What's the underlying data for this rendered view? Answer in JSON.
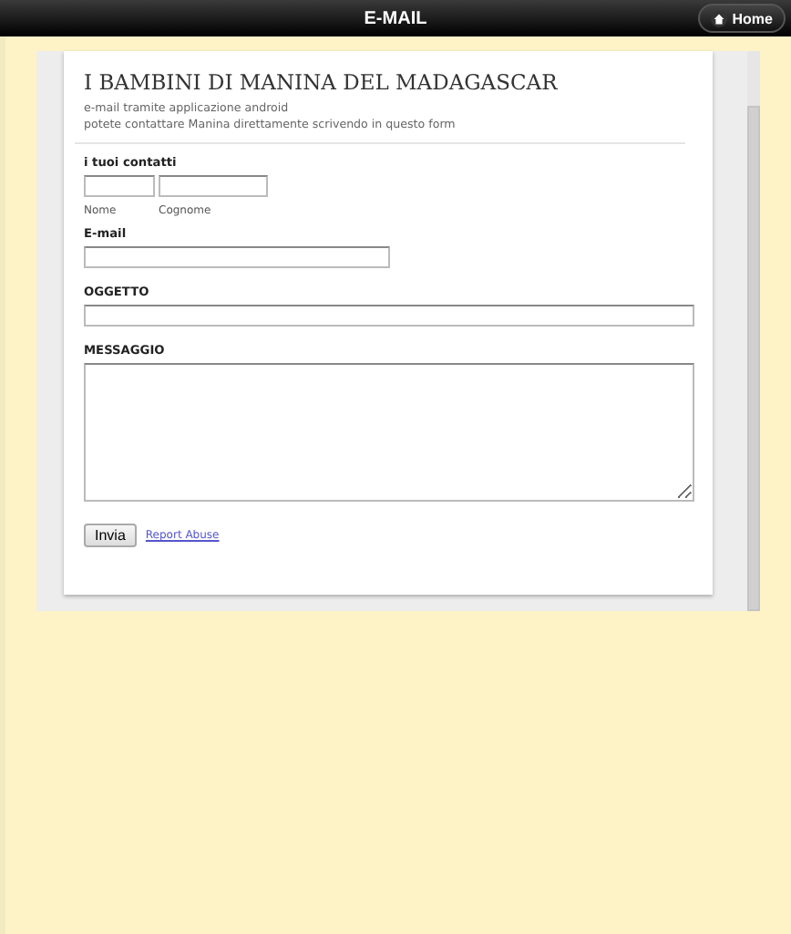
{
  "header": {
    "title": "E-MAIL",
    "home_button": "Home"
  },
  "form": {
    "title": "I BAMBINI DI MANINA DEL MADAGASCAR",
    "description": [
      "e-mail tramite applicazione android",
      "potete contattare Manina direttamente scrivendo in questo form"
    ],
    "contacts_label": "i tuoi contatti",
    "first_name_caption": "Nome",
    "last_name_caption": "Cognome",
    "email_label": "E-mail",
    "subject_label": "OGGETTO",
    "message_label": "MESSAGGIO",
    "submit_button": "Invia",
    "report_link": "Report Abuse"
  }
}
